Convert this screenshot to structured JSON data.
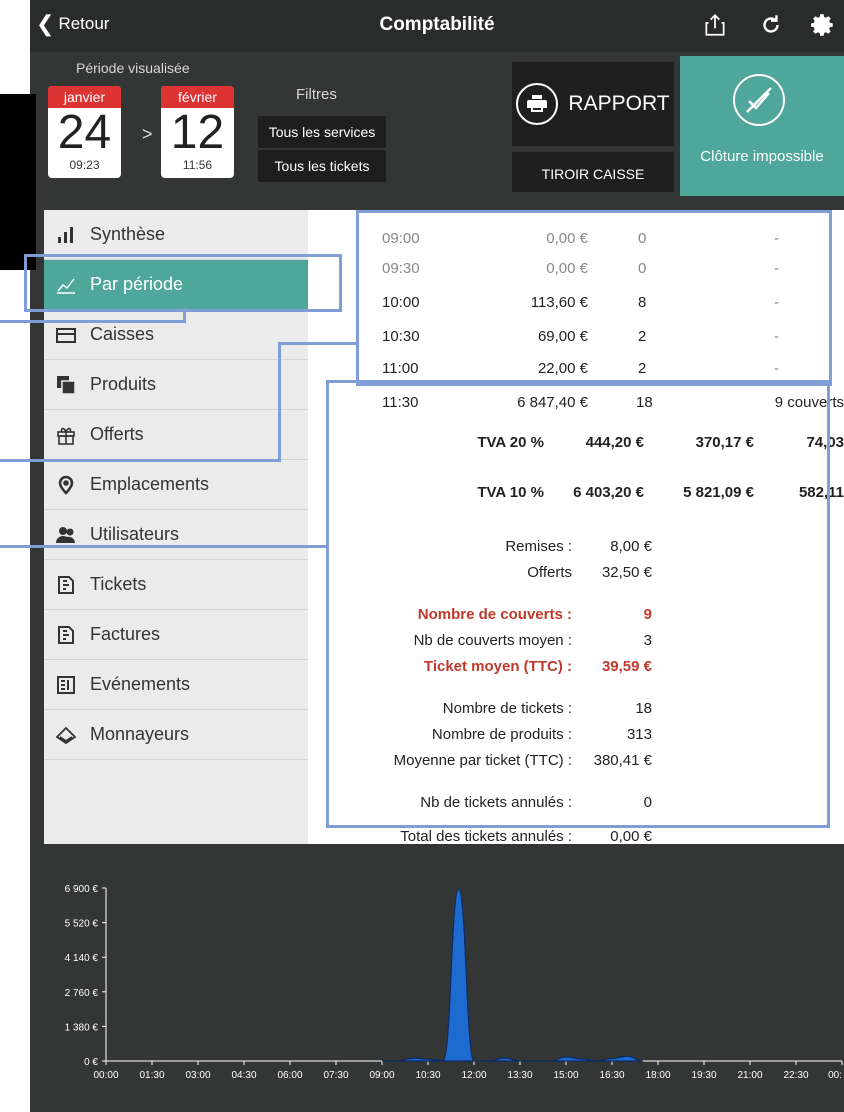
{
  "topbar": {
    "back_label": "Retour",
    "title": "Comptabilité",
    "icons": [
      "share-icon",
      "refresh-icon",
      "gear-icon"
    ]
  },
  "header": {
    "periode_label": "Période visualisée",
    "start": {
      "month": "janvier",
      "day": "24",
      "time": "09:23"
    },
    "separator": ">",
    "end": {
      "month": "février",
      "day": "12",
      "time": "11:56"
    },
    "filtres_label": "Filtres",
    "filter_services": "Tous les services",
    "filter_tickets": "Tous les tickets",
    "rapport_label": "RAPPORT",
    "tiroir_label": "TIROIR CAISSE",
    "cloture_label": "Clôture impossible"
  },
  "sidebar": {
    "items": [
      {
        "label": "Synthèse",
        "icon": "bar-chart-icon"
      },
      {
        "label": "Par période",
        "icon": "line-chart-icon"
      },
      {
        "label": "Caisses",
        "icon": "cash-register-icon"
      },
      {
        "label": "Produits",
        "icon": "products-icon"
      },
      {
        "label": "Offerts",
        "icon": "gift-icon"
      },
      {
        "label": "Emplacements",
        "icon": "location-pin-icon"
      },
      {
        "label": "Utilisateurs",
        "icon": "users-icon"
      },
      {
        "label": "Tickets",
        "icon": "ticket-icon"
      },
      {
        "label": "Factures",
        "icon": "invoice-icon"
      },
      {
        "label": "Evénements",
        "icon": "events-icon"
      },
      {
        "label": "Monnayeurs",
        "icon": "coin-changer-icon"
      }
    ]
  },
  "periods": [
    {
      "time": "09:00",
      "amount": "0,00 €",
      "count": "0",
      "covers": "-"
    },
    {
      "time": "09:30",
      "amount": "0,00 €",
      "count": "0",
      "covers": "-"
    },
    {
      "time": "10:00",
      "amount": "113,60 €",
      "count": "8",
      "covers": "-"
    },
    {
      "time": "10:30",
      "amount": "69,00 €",
      "count": "2",
      "covers": "-"
    },
    {
      "time": "11:00",
      "amount": "22,00 €",
      "count": "2",
      "covers": "-"
    },
    {
      "time": "11:30",
      "amount": "6 847,40 €",
      "count": "18",
      "covers": "9 couverts"
    }
  ],
  "tva": [
    {
      "label": "TVA 20 %",
      "ttc": "444,20 €",
      "ht": "370,17 €",
      "tva": "74,03"
    },
    {
      "label": "TVA 10 %",
      "ttc": "6 403,20 €",
      "ht": "5 821,09 €",
      "tva": "582,11"
    }
  ],
  "summary": {
    "remises_label": "Remises :",
    "remises_value": "8,00 €",
    "offerts_label": "Offerts",
    "offerts_value": "32,50 €",
    "couverts_label": "Nombre de couverts :",
    "couverts_value": "9",
    "couverts_moyen_label": "Nb de couverts moyen :",
    "couverts_moyen_value": "3",
    "ticket_moyen_label": "Ticket moyen (TTC) :",
    "ticket_moyen_value": "39,59 €",
    "nb_tickets_label": "Nombre de tickets :",
    "nb_tickets_value": "18",
    "nb_produits_label": "Nombre de produits :",
    "nb_produits_value": "313",
    "moyenne_label": "Moyenne par ticket (TTC) :",
    "moyenne_value": "380,41 €",
    "annules_label": "Nb de tickets annulés :",
    "annules_value": "0",
    "total_annules_label": "Total des tickets annulés :",
    "total_annules_value": "0,00 €"
  },
  "colors": {
    "accent": "#4fa69a",
    "red": "#c0392b",
    "highlight": "#7f9dd6",
    "series": "#1e6fd8"
  },
  "chart_data": {
    "type": "area",
    "x": [
      "00:00",
      "01:30",
      "03:00",
      "04:30",
      "06:00",
      "07:30",
      "09:00",
      "10:30",
      "12:00",
      "13:30",
      "15:00",
      "16:30",
      "18:00",
      "19:30",
      "21:00",
      "22:30",
      "00:"
    ],
    "y_ticks": [
      "6 900 €",
      "5 520 €",
      "4 140 €",
      "2 760 €",
      "1 380 €",
      "0 €"
    ],
    "ylim": [
      0,
      6900
    ],
    "series": [
      {
        "points": [
          {
            "t": 9.0,
            "v": 0
          },
          {
            "t": 9.5,
            "v": 0
          },
          {
            "t": 10.0,
            "v": 113.6
          },
          {
            "t": 10.5,
            "v": 69
          },
          {
            "t": 11.0,
            "v": 22
          },
          {
            "t": 11.5,
            "v": 6847.4
          },
          {
            "t": 12.0,
            "v": 0
          },
          {
            "t": 12.5,
            "v": 0
          },
          {
            "t": 13.0,
            "v": 120
          },
          {
            "t": 13.5,
            "v": 0
          },
          {
            "t": 14.5,
            "v": 0
          },
          {
            "t": 15.0,
            "v": 160
          },
          {
            "t": 15.5,
            "v": 80
          },
          {
            "t": 16.0,
            "v": 0
          },
          {
            "t": 16.5,
            "v": 100
          },
          {
            "t": 17.0,
            "v": 190
          },
          {
            "t": 17.5,
            "v": 0
          }
        ]
      }
    ]
  }
}
